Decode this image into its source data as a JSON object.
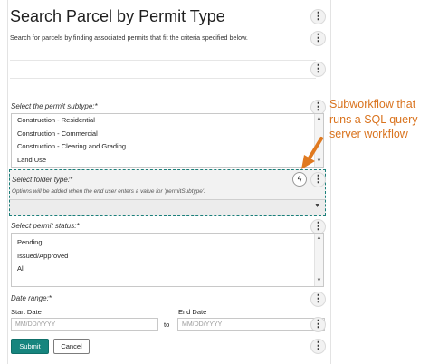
{
  "form": {
    "title": "Search Parcel by Permit Type",
    "description": "Search for parcels by finding associated permits that fit the criteria specified below.",
    "permit_subtype": {
      "label": "Select the permit subtype:*",
      "options": [
        "Construction - Residential",
        "Construction - Commercial",
        "Construction - Clearing and Grading",
        "Land Use"
      ]
    },
    "folder_type": {
      "label": "Select folder type:*",
      "hint": "Options will be added when the end user enters a value for 'permitSubtype'."
    },
    "permit_status": {
      "label": "Select permit status:*",
      "options": [
        "Pending",
        "Issued/Approved",
        "All"
      ]
    },
    "date_range": {
      "label": "Date range:*",
      "start_label": "Start Date",
      "end_label": "End Date",
      "start_placeholder": "MM/DD/YYYY",
      "end_placeholder": "MM/DD/YYYY",
      "to_text": "to"
    },
    "buttons": {
      "submit": "Submit",
      "cancel": "Cancel"
    }
  },
  "annotation": {
    "text": "Subworkflow that runs a SQL query server workflow",
    "color": "#d9731e"
  },
  "colors": {
    "accent": "#16857e",
    "highlight_border": "#1b7f7a"
  },
  "icons": {
    "more": "vertical-ellipsis",
    "subworkflow": "lightning-bolt",
    "dropdown": "caret-down"
  }
}
